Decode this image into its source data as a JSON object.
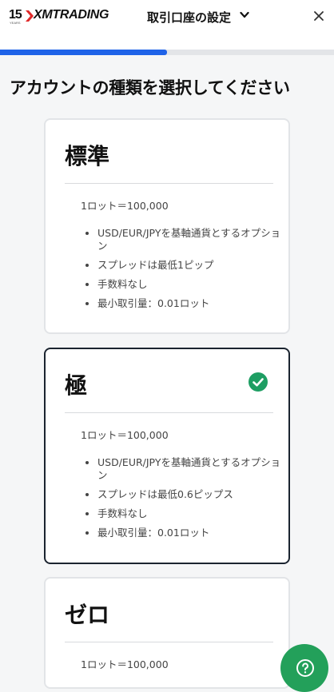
{
  "header": {
    "logo_number": "15",
    "logo_years": "YEARS",
    "logo_text": "XMTRADING",
    "title": "取引口座の設定"
  },
  "progress_fraction": 0.5,
  "page_heading": "アカウントの種類を選択してください",
  "cards": [
    {
      "title": "標準",
      "lot": "1ロット＝100,000",
      "features": [
        "USD/EUR/JPYを基軸通貨とするオプション",
        "スプレッドは最低1ピップ",
        "手数料なし",
        "最小取引量：0.01ロット"
      ],
      "selected": false
    },
    {
      "title": "極",
      "lot": "1ロット＝100,000",
      "features": [
        "USD/EUR/JPYを基軸通貨とするオプション",
        "スプレッドは最低0.6ピップス",
        "手数料なし",
        "最小取引量：0.01ロット"
      ],
      "selected": true
    },
    {
      "title": "ゼロ",
      "lot": "1ロット＝100,000",
      "selected": false
    }
  ],
  "colors": {
    "accent": "#1f63e8",
    "selected_border": "#1b2430",
    "check_green": "#1e9e63",
    "help_green": "#23a05a"
  },
  "icons": {
    "chevron": "chevron-down-icon",
    "close": "close-icon",
    "check": "check-circle-icon",
    "help": "help-icon"
  }
}
